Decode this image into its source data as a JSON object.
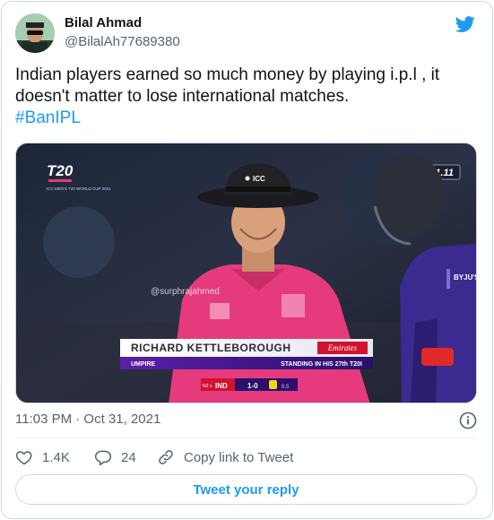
{
  "user": {
    "name": "Bilal Ahmad",
    "handle": "@BilalAh77689380"
  },
  "tweet": {
    "text": "Indian players earned so much money by playing i.p.l , it doesn't matter to lose international matches.",
    "hashtag": "#BanIPL",
    "timestamp": "11:03 PM · Oct 31, 2021"
  },
  "media": {
    "event_logo_text": "T20",
    "event_logo_sub": "ICC MEN'S T20 WORLD CUP 2021",
    "clock": "11.11",
    "cap_logo": "ICC",
    "watermark": "@surphrajahmed",
    "umpire_name": "RICHARD KETTLEBOROUGH",
    "sponsor": "Emirates",
    "umpire_role": "UMPIRE",
    "umpire_detail": "STANDING IN HIS 27th T20I",
    "score_team": "IND",
    "score_value": "1-0",
    "score_overs": "0.5",
    "score_prefix": "NZ v",
    "player_sponsor": "BYJU'S"
  },
  "actions": {
    "likes": "1.4K",
    "replies": "24",
    "copy_link": "Copy link to Tweet"
  },
  "reply_button": "Tweet your reply",
  "colors": {
    "accent": "#1d9bf0",
    "text": "#0f1419",
    "muted": "#536471",
    "umpire_shirt": "#e03a7a",
    "team_jersey": "#3b2a8f"
  }
}
